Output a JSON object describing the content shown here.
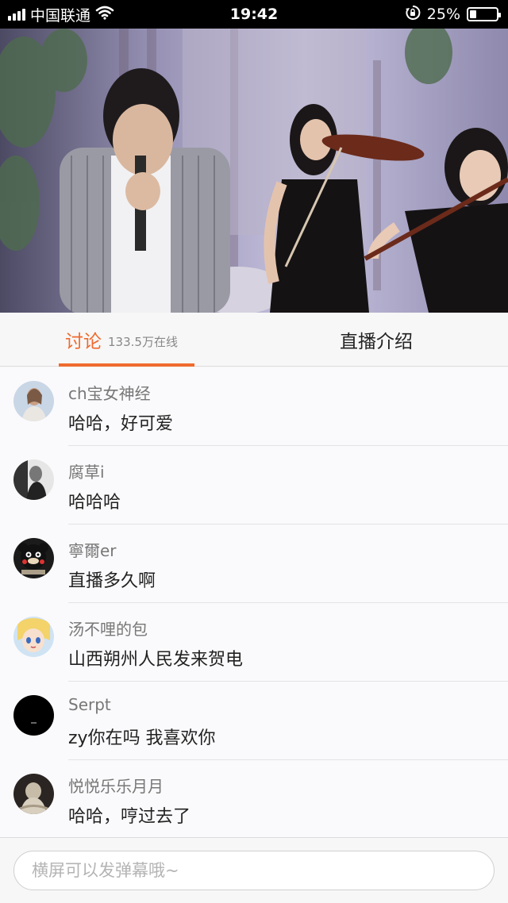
{
  "status_bar": {
    "carrier": "中国联通",
    "time": "19:42",
    "battery_text": "25%",
    "battery_level": 0.25,
    "icons": [
      "signal-icon",
      "wifi-icon",
      "orientation-lock-icon",
      "battery-icon"
    ]
  },
  "video": {
    "description_icon": "live-video-frame"
  },
  "tabs": {
    "discuss_label": "讨论",
    "online_count": "133.5万在线",
    "intro_label": "直播介绍",
    "active": "discuss",
    "accent_color": "#ef6a2e"
  },
  "comments": [
    {
      "user": "ch宝女神经",
      "text": "哈哈，好可爱",
      "avatar": "photo-avatar-woman"
    },
    {
      "user": "腐草i",
      "text": "哈哈哈",
      "avatar": "bw-photo-avatar"
    },
    {
      "user": "寧爾er",
      "text": "直播多久啊",
      "avatar": "kumamon-avatar"
    },
    {
      "user": "汤不哩的包",
      "text": "山西朔州人民发来贺电",
      "avatar": "anime-avatar"
    },
    {
      "user": "Serpt",
      "text": "zy你在吗 我喜欢你",
      "avatar": "black-avatar"
    },
    {
      "user": "悦悦乐乐月月",
      "text": "哈哈，哼过去了",
      "avatar": "dark-photo-avatar"
    }
  ],
  "input": {
    "placeholder": "横屏可以发弹幕哦~",
    "value": ""
  }
}
